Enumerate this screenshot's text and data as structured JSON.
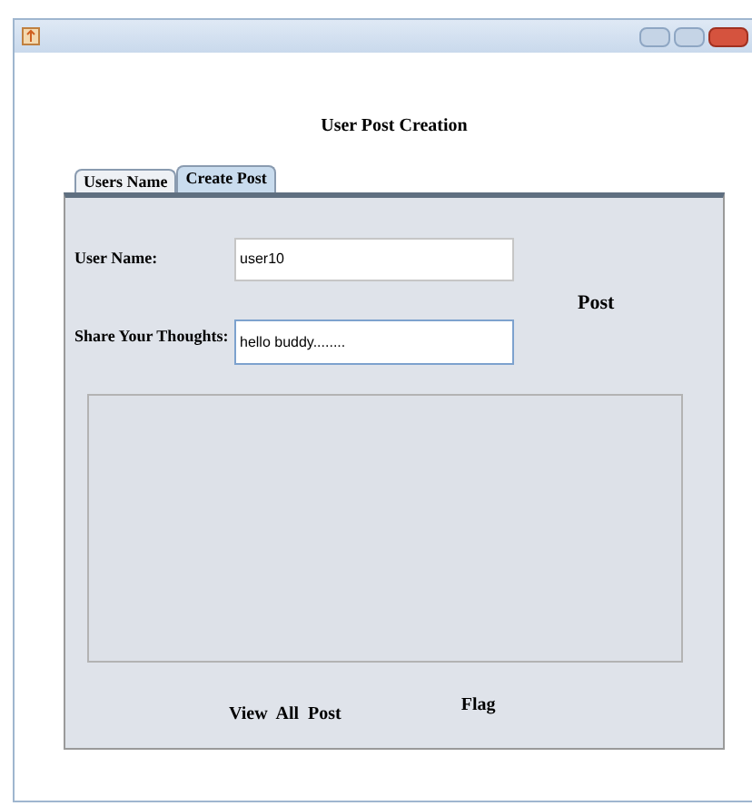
{
  "window": {
    "title": "User Post Creation"
  },
  "tabs": [
    {
      "label": "Users Name",
      "selected": false
    },
    {
      "label": "Create Post",
      "selected": true
    }
  ],
  "form": {
    "user_name": {
      "label": "User Name:",
      "value": "user10"
    },
    "thoughts": {
      "label": "Share Your Thoughts:",
      "value": "hello buddy........"
    },
    "post_button": "Post"
  },
  "buttons": [
    "View  All  Post",
    "Flag"
  ]
}
